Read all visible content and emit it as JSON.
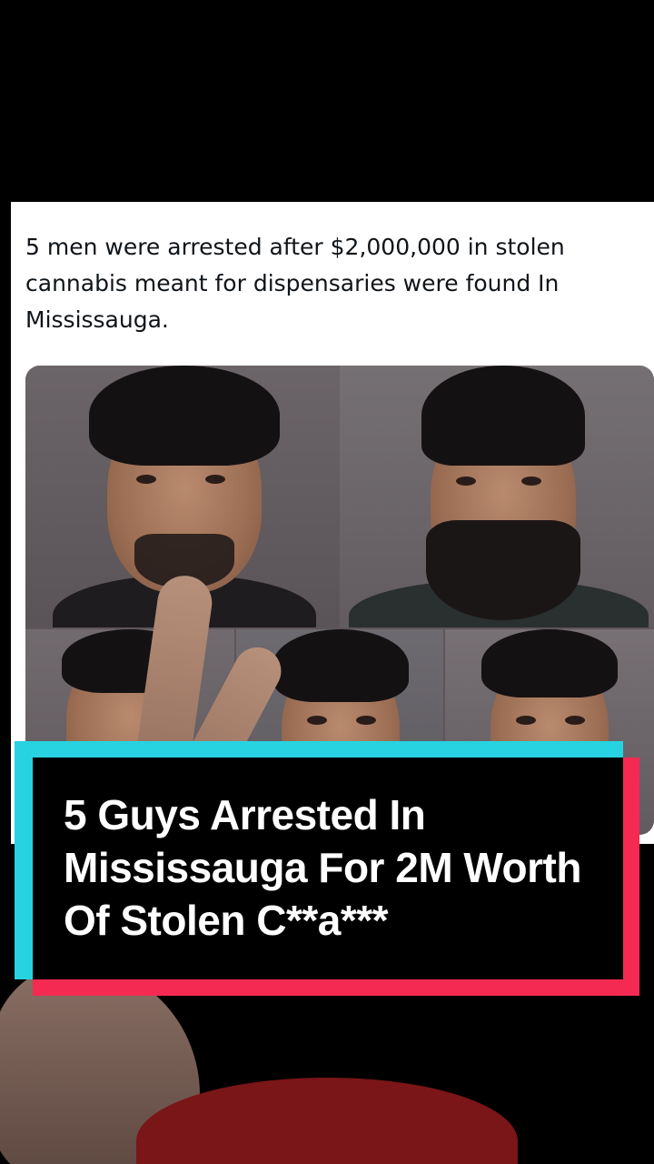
{
  "post": {
    "text": "5 men were arrested after $2,000,000 in stolen cannabis meant for dispensaries were found In Mississauga."
  },
  "caption": {
    "text": "5 Guys Arrested In Mississauga For 2M Worth Of Stolen C**a***"
  },
  "colors": {
    "banner_cyan": "#27d3e0",
    "banner_red": "#f52a52",
    "banner_black": "#000000",
    "caption_text": "#ffffff"
  }
}
